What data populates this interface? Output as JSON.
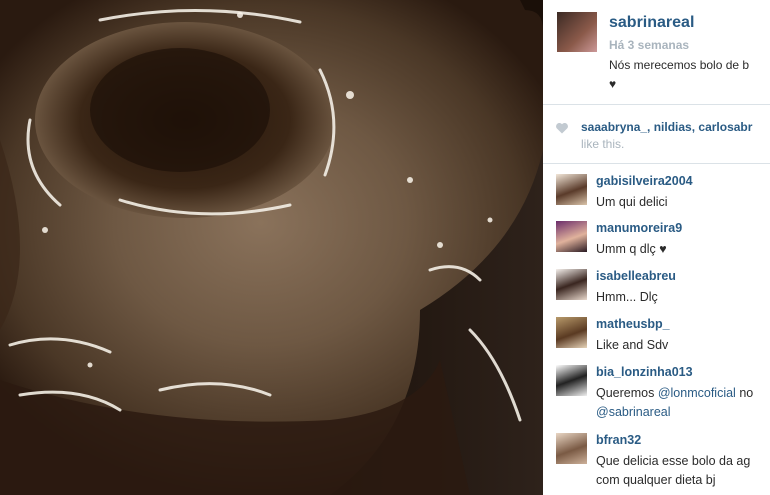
{
  "post": {
    "owner": {
      "username": "sabrinareal",
      "time_ago": "Há 3 semanas",
      "caption_line1": "Nós merecemos bolo de b",
      "caption_line2": "♥"
    },
    "likes": {
      "names": "saaabryna_, nildias, carlosabr",
      "suffix": "like this."
    },
    "comments": [
      {
        "username": "gabisilveira2004",
        "text": "Um qui delici"
      },
      {
        "username": "manumoreira9",
        "text": "Umm q dlç ♥"
      },
      {
        "username": "isabelleabreu",
        "text": "Hmm... Dlç"
      },
      {
        "username": "matheusbp_",
        "text": "Like and Sdv"
      },
      {
        "username": "bia_lonzinha013",
        "text_prefix": "Queremos ",
        "mention1": "@lonmcoficial",
        "text_mid": " no",
        "mention2": "@sabrinareal"
      },
      {
        "username": "bfran32",
        "text": "Que delicia esse bolo da ag",
        "text_line2": "com qualquer dieta bj"
      }
    ]
  },
  "colors": {
    "link": "#2a5b84",
    "meta": "#a9b4bd",
    "text": "#2b2b2b"
  },
  "icons": [
    "heart-icon",
    "avatar"
  ]
}
